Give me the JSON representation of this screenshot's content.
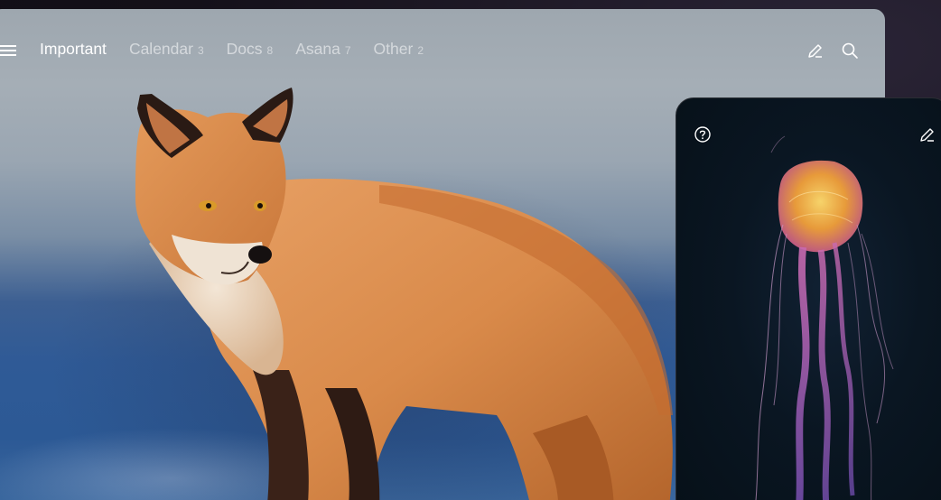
{
  "app": {
    "accent_color": "#ffffff",
    "inactive_tab_color": "#8b939b"
  },
  "topbar": {
    "menu_icon": "hamburger-menu-icon",
    "tabs": [
      {
        "label": "Important",
        "count": "",
        "active": true
      },
      {
        "label": "Calendar",
        "count": "3",
        "active": false
      },
      {
        "label": "Docs",
        "count": "8",
        "active": false
      },
      {
        "label": "Asana",
        "count": "7",
        "active": false
      },
      {
        "label": "Other",
        "count": "2",
        "active": false
      }
    ],
    "actions": [
      {
        "icon": "pencil-icon"
      },
      {
        "icon": "search-icon"
      }
    ]
  },
  "main_wallpaper": {
    "subject": "fox-photo"
  },
  "phone": {
    "help_icon": "help-circle-icon",
    "edit_icon": "pencil-icon",
    "wallpaper": {
      "subject": "jellyfish-photo"
    }
  }
}
